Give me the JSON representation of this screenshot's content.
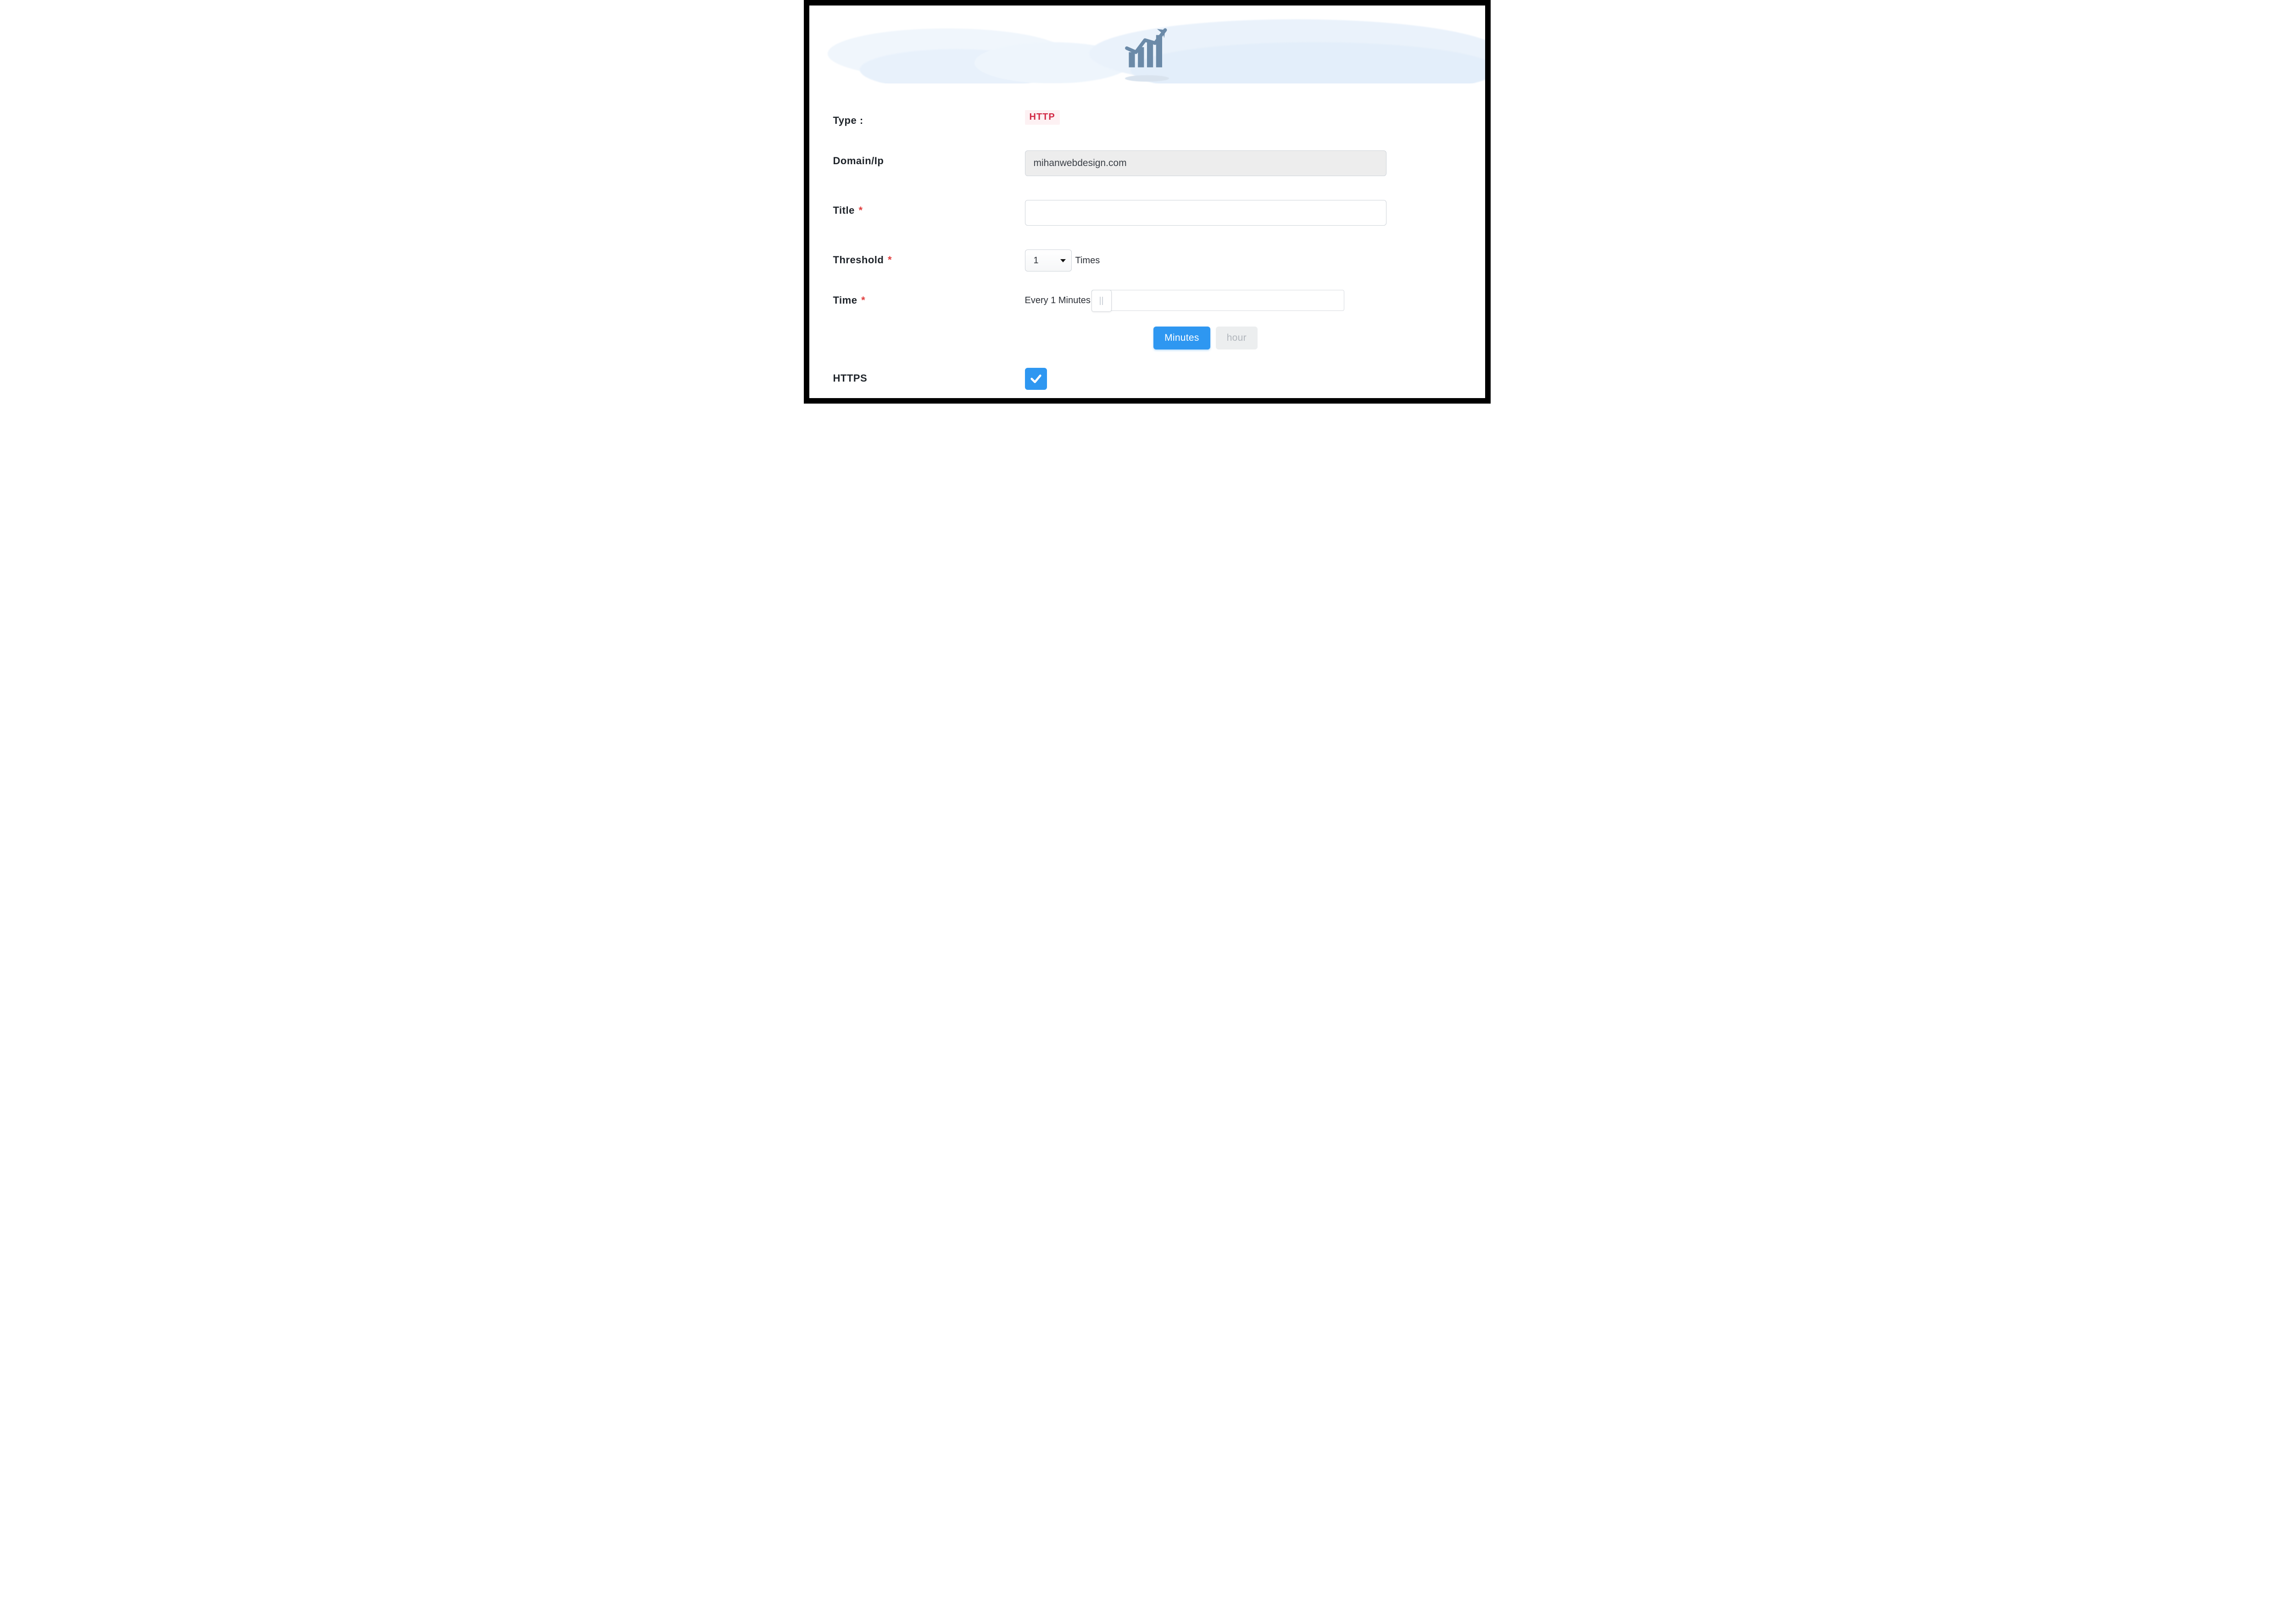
{
  "form": {
    "type_label": "Type :",
    "type_value": "HTTP",
    "domain_label": "Domain/Ip",
    "domain_value": "mihanwebdesign.com",
    "title_label": "Title",
    "title_value": "",
    "threshold_label": "Threshold",
    "threshold_value": "1",
    "threshold_suffix": "Times",
    "time_label": "Time",
    "time_text": "Every 1 Minutes",
    "btn_minutes": "Minutes",
    "btn_hour": "hour",
    "https_label": "HTTPS",
    "required_mark": "*"
  }
}
